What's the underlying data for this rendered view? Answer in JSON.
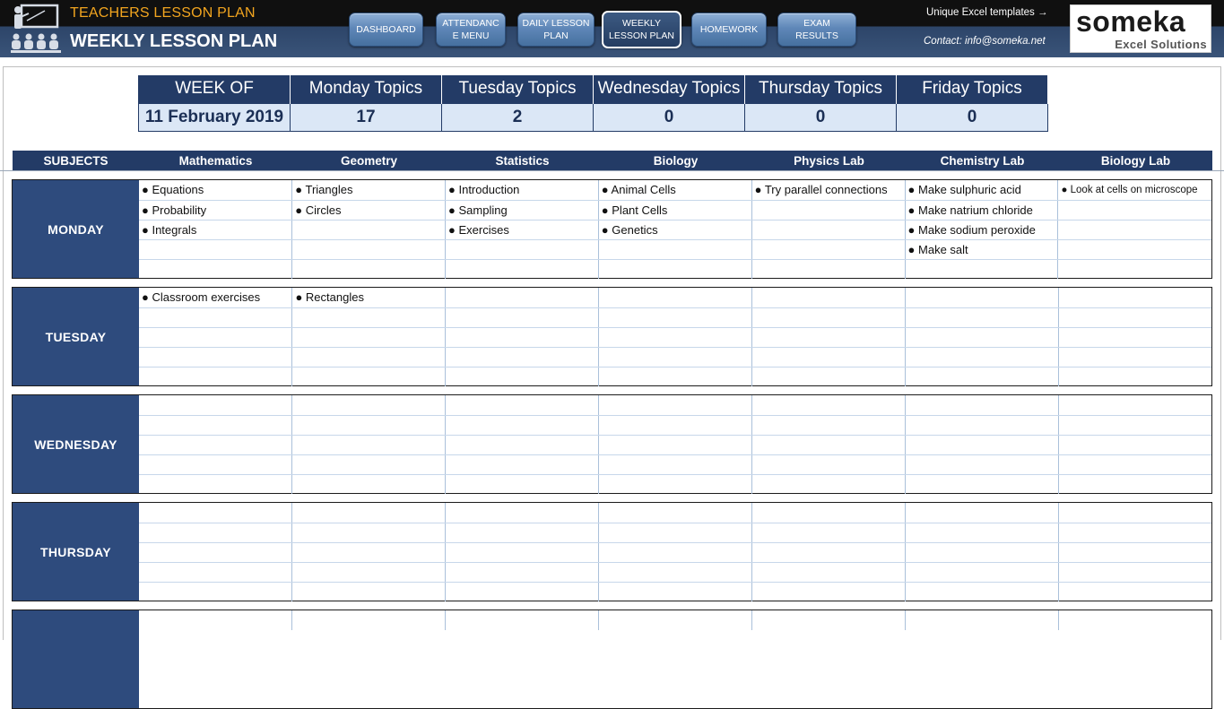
{
  "header": {
    "app_title": "TEACHERS LESSON PLAN",
    "page_title": "WEEKLY LESSON PLAN",
    "promo": "Unique Excel templates →",
    "contact": "Contact: info@someka.net",
    "brand_name": "someka",
    "brand_sub": "Excel Solutions",
    "logo_icon": "teacher-classroom-icon"
  },
  "nav": [
    {
      "label": "DASHBOARD",
      "active": false
    },
    {
      "label": "ATTENDANC E MENU",
      "active": false
    },
    {
      "label": "DAILY LESSON PLAN",
      "active": false
    },
    {
      "label": "WEEKLY LESSON PLAN",
      "active": true
    },
    {
      "label": "HOMEWORK",
      "active": false
    },
    {
      "label": "EXAM RESULTS",
      "active": false
    }
  ],
  "summary": {
    "headers": [
      "WEEK OF",
      "Monday Topics",
      "Tuesday Topics",
      "Wednesday Topics",
      "Thursday Topics",
      "Friday Topics"
    ],
    "values": [
      "11 February 2019",
      "17",
      "2",
      "0",
      "0",
      "0"
    ]
  },
  "subjects": [
    "SUBJECTS",
    "Mathematics",
    "Geometry",
    "Statistics",
    "Biology",
    "Physics Lab",
    "Chemistry Lab",
    "Biology Lab"
  ],
  "days": [
    {
      "name": "MONDAY",
      "rows": [
        [
          "● Equations",
          "● Triangles",
          "● Introduction",
          "● Animal Cells",
          "● Try parallel connections",
          "● Make sulphuric acid",
          "● Look at cells on microscope"
        ],
        [
          "● Probability",
          "● Circles",
          "● Sampling",
          "● Plant Cells",
          "",
          "● Make natrium chloride",
          ""
        ],
        [
          "● Integrals",
          "",
          "● Exercises",
          "● Genetics",
          "",
          "● Make sodium peroxide",
          ""
        ],
        [
          "",
          "",
          "",
          "",
          "",
          "● Make salt",
          ""
        ],
        [
          "",
          "",
          "",
          "",
          "",
          "",
          ""
        ]
      ]
    },
    {
      "name": "TUESDAY",
      "rows": [
        [
          "● Classroom exercises",
          "● Rectangles",
          "",
          "",
          "",
          "",
          ""
        ],
        [
          "",
          "",
          "",
          "",
          "",
          "",
          ""
        ],
        [
          "",
          "",
          "",
          "",
          "",
          "",
          ""
        ],
        [
          "",
          "",
          "",
          "",
          "",
          "",
          ""
        ],
        [
          "",
          "",
          "",
          "",
          "",
          "",
          ""
        ]
      ]
    },
    {
      "name": "WEDNESDAY",
      "rows": [
        [
          "",
          "",
          "",
          "",
          "",
          "",
          ""
        ],
        [
          "",
          "",
          "",
          "",
          "",
          "",
          ""
        ],
        [
          "",
          "",
          "",
          "",
          "",
          "",
          ""
        ],
        [
          "",
          "",
          "",
          "",
          "",
          "",
          ""
        ],
        [
          "",
          "",
          "",
          "",
          "",
          "",
          ""
        ]
      ]
    },
    {
      "name": "THURSDAY",
      "rows": [
        [
          "",
          "",
          "",
          "",
          "",
          "",
          ""
        ],
        [
          "",
          "",
          "",
          "",
          "",
          "",
          ""
        ],
        [
          "",
          "",
          "",
          "",
          "",
          "",
          ""
        ],
        [
          "",
          "",
          "",
          "",
          "",
          "",
          ""
        ],
        [
          "",
          "",
          "",
          "",
          "",
          "",
          ""
        ]
      ]
    },
    {
      "name": "",
      "rows": [
        [
          "",
          "",
          "",
          "",
          "",
          "",
          ""
        ]
      ]
    }
  ]
}
